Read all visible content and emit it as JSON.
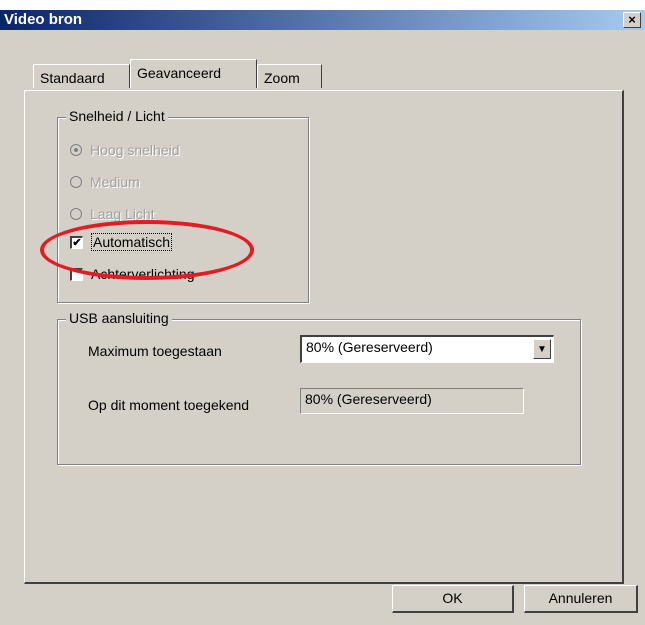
{
  "window": {
    "title": "Video bron",
    "close_label": "×"
  },
  "tabs": [
    {
      "label": "Standaard",
      "active": false
    },
    {
      "label": "Geavanceerd",
      "active": true
    },
    {
      "label": "Zoom",
      "active": false
    }
  ],
  "speed_group": {
    "title": "Snelheid / Licht",
    "radios": [
      {
        "label": "Hoog snelheid",
        "checked": true,
        "enabled": false
      },
      {
        "label": "Medium",
        "checked": false,
        "enabled": false
      },
      {
        "label": "Laag Licht",
        "checked": false,
        "enabled": false
      }
    ],
    "checkboxes": [
      {
        "label": "Automatisch",
        "checked": true,
        "check_mark": "✔"
      },
      {
        "label": "Achterverlichting",
        "checked": false,
        "check_mark": ""
      }
    ]
  },
  "usb_group": {
    "title": "USB aansluiting",
    "max_label": "Maximum toegestaan",
    "max_value": "80% (Gereserveerd)",
    "dropdown_arrow": "▼",
    "current_label": "Op dit moment toegekend",
    "current_value": "80% (Gereserveerd)"
  },
  "buttons": {
    "ok": "OK",
    "cancel": "Annuleren"
  },
  "colors": {
    "highlight": "#e31b23",
    "titlebar": "#0a246a",
    "face": "#d4d0c8"
  }
}
